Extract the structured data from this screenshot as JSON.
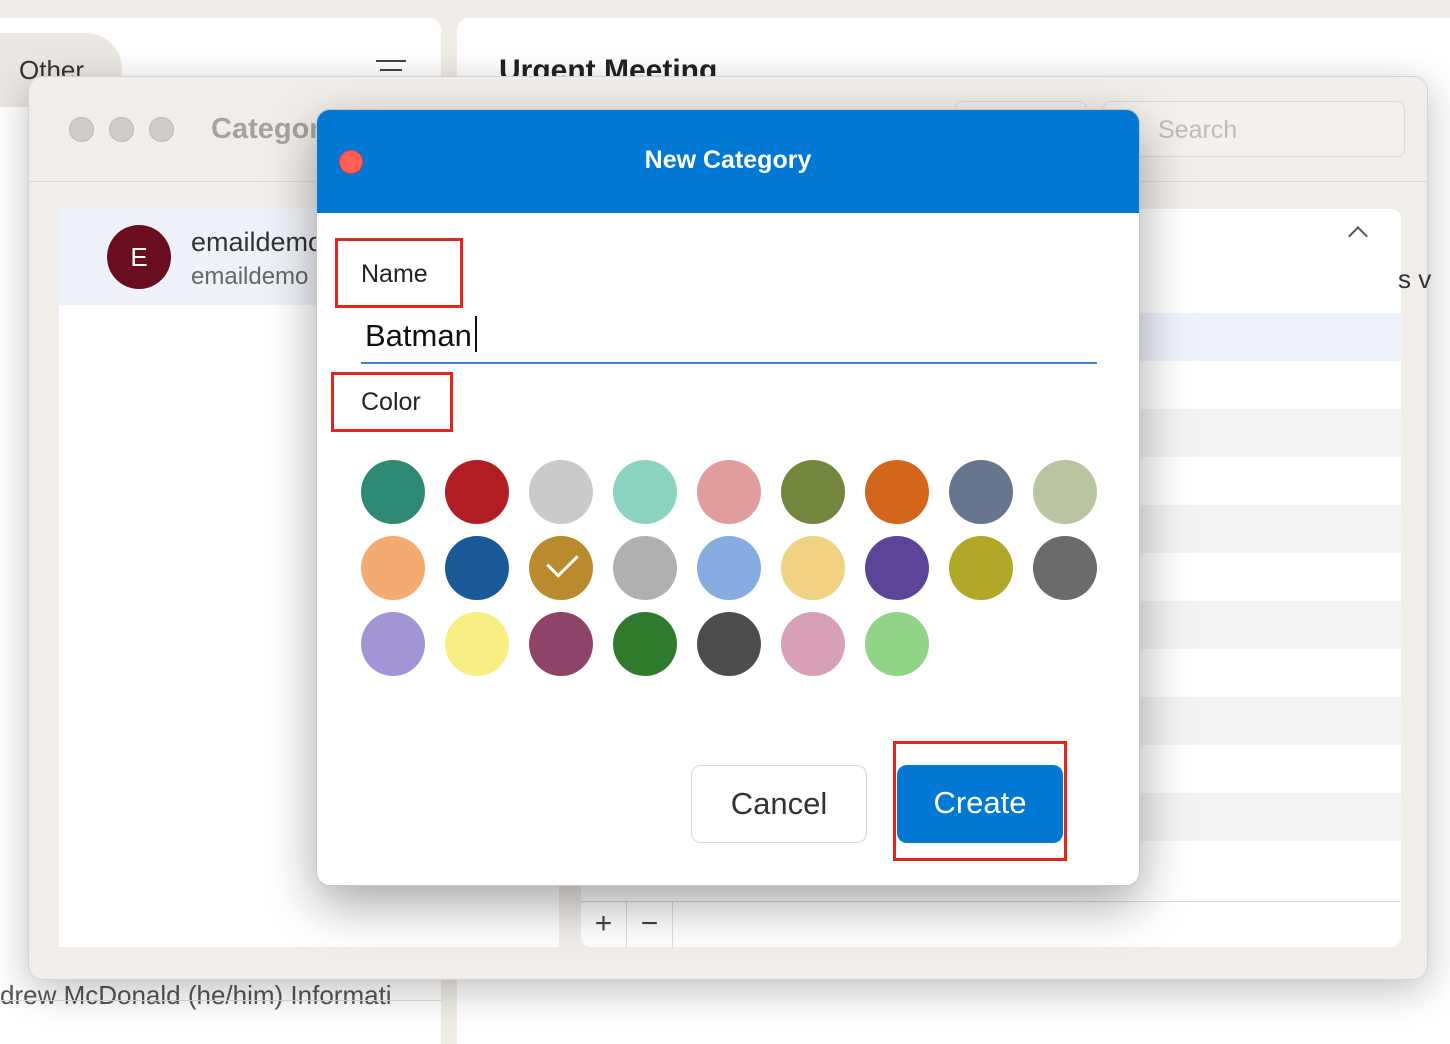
{
  "background": {
    "list_tab_label": "Other",
    "list_footer_text": "drew McDonald (he/him) Informati",
    "reading_title": "Urgent Meeting"
  },
  "categories_window": {
    "title": "Categories",
    "search_placeholder": "Search",
    "account": {
      "avatar_letter": "E",
      "name": "emaildemo",
      "email": "emaildemo"
    },
    "stray_text": "s v",
    "add_label": "+",
    "remove_label": "−"
  },
  "dialog": {
    "title": "New Category",
    "name_label": "Name",
    "name_value": "Batman",
    "color_label": "Color",
    "cancel_label": "Cancel",
    "create_label": "Create",
    "colors": [
      [
        "#2e8a73",
        "#b01e23",
        "#cacacd",
        "#8bd3c0",
        "#e09d9d",
        "#72873d",
        "#d4661b",
        "#67768f",
        "#b8c5a0"
      ],
      [
        "#f4ab72",
        "#1a5896",
        "#b98a2e",
        "#b0b0b0",
        "#86abe0",
        "#f0d282",
        "#5c4498",
        "#b2a827",
        "#6b6b6b"
      ],
      [
        "#a394d6",
        "#f8ef84",
        "#8e4468",
        "#2f7a2d",
        "#4d4d4d",
        "#d8a0b6",
        "#91d487"
      ]
    ],
    "selected_color": "#b98a2e"
  }
}
